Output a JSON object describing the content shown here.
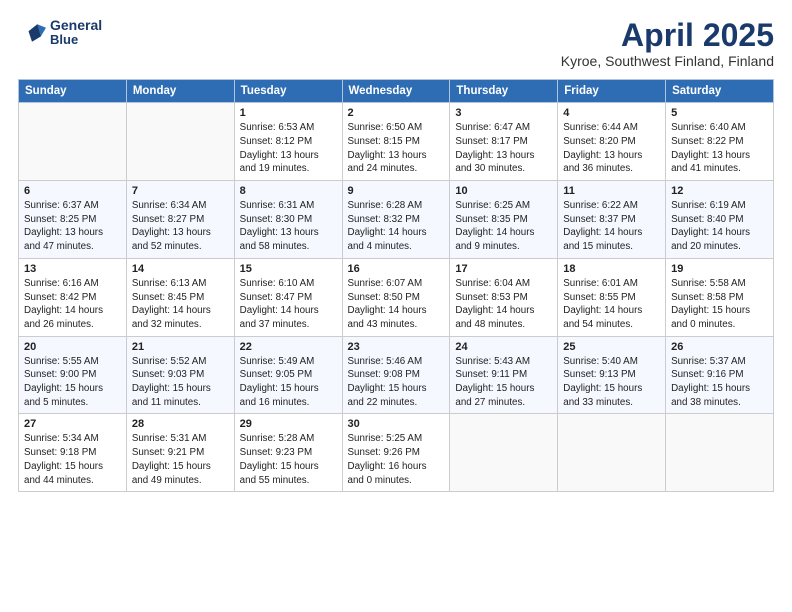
{
  "header": {
    "logo_line1": "General",
    "logo_line2": "Blue",
    "title": "April 2025",
    "subtitle": "Kyroe, Southwest Finland, Finland"
  },
  "weekdays": [
    "Sunday",
    "Monday",
    "Tuesday",
    "Wednesday",
    "Thursday",
    "Friday",
    "Saturday"
  ],
  "weeks": [
    [
      {
        "day": "",
        "detail": ""
      },
      {
        "day": "",
        "detail": ""
      },
      {
        "day": "1",
        "detail": "Sunrise: 6:53 AM\nSunset: 8:12 PM\nDaylight: 13 hours and 19 minutes."
      },
      {
        "day": "2",
        "detail": "Sunrise: 6:50 AM\nSunset: 8:15 PM\nDaylight: 13 hours and 24 minutes."
      },
      {
        "day": "3",
        "detail": "Sunrise: 6:47 AM\nSunset: 8:17 PM\nDaylight: 13 hours and 30 minutes."
      },
      {
        "day": "4",
        "detail": "Sunrise: 6:44 AM\nSunset: 8:20 PM\nDaylight: 13 hours and 36 minutes."
      },
      {
        "day": "5",
        "detail": "Sunrise: 6:40 AM\nSunset: 8:22 PM\nDaylight: 13 hours and 41 minutes."
      }
    ],
    [
      {
        "day": "6",
        "detail": "Sunrise: 6:37 AM\nSunset: 8:25 PM\nDaylight: 13 hours and 47 minutes."
      },
      {
        "day": "7",
        "detail": "Sunrise: 6:34 AM\nSunset: 8:27 PM\nDaylight: 13 hours and 52 minutes."
      },
      {
        "day": "8",
        "detail": "Sunrise: 6:31 AM\nSunset: 8:30 PM\nDaylight: 13 hours and 58 minutes."
      },
      {
        "day": "9",
        "detail": "Sunrise: 6:28 AM\nSunset: 8:32 PM\nDaylight: 14 hours and 4 minutes."
      },
      {
        "day": "10",
        "detail": "Sunrise: 6:25 AM\nSunset: 8:35 PM\nDaylight: 14 hours and 9 minutes."
      },
      {
        "day": "11",
        "detail": "Sunrise: 6:22 AM\nSunset: 8:37 PM\nDaylight: 14 hours and 15 minutes."
      },
      {
        "day": "12",
        "detail": "Sunrise: 6:19 AM\nSunset: 8:40 PM\nDaylight: 14 hours and 20 minutes."
      }
    ],
    [
      {
        "day": "13",
        "detail": "Sunrise: 6:16 AM\nSunset: 8:42 PM\nDaylight: 14 hours and 26 minutes."
      },
      {
        "day": "14",
        "detail": "Sunrise: 6:13 AM\nSunset: 8:45 PM\nDaylight: 14 hours and 32 minutes."
      },
      {
        "day": "15",
        "detail": "Sunrise: 6:10 AM\nSunset: 8:47 PM\nDaylight: 14 hours and 37 minutes."
      },
      {
        "day": "16",
        "detail": "Sunrise: 6:07 AM\nSunset: 8:50 PM\nDaylight: 14 hours and 43 minutes."
      },
      {
        "day": "17",
        "detail": "Sunrise: 6:04 AM\nSunset: 8:53 PM\nDaylight: 14 hours and 48 minutes."
      },
      {
        "day": "18",
        "detail": "Sunrise: 6:01 AM\nSunset: 8:55 PM\nDaylight: 14 hours and 54 minutes."
      },
      {
        "day": "19",
        "detail": "Sunrise: 5:58 AM\nSunset: 8:58 PM\nDaylight: 15 hours and 0 minutes."
      }
    ],
    [
      {
        "day": "20",
        "detail": "Sunrise: 5:55 AM\nSunset: 9:00 PM\nDaylight: 15 hours and 5 minutes."
      },
      {
        "day": "21",
        "detail": "Sunrise: 5:52 AM\nSunset: 9:03 PM\nDaylight: 15 hours and 11 minutes."
      },
      {
        "day": "22",
        "detail": "Sunrise: 5:49 AM\nSunset: 9:05 PM\nDaylight: 15 hours and 16 minutes."
      },
      {
        "day": "23",
        "detail": "Sunrise: 5:46 AM\nSunset: 9:08 PM\nDaylight: 15 hours and 22 minutes."
      },
      {
        "day": "24",
        "detail": "Sunrise: 5:43 AM\nSunset: 9:11 PM\nDaylight: 15 hours and 27 minutes."
      },
      {
        "day": "25",
        "detail": "Sunrise: 5:40 AM\nSunset: 9:13 PM\nDaylight: 15 hours and 33 minutes."
      },
      {
        "day": "26",
        "detail": "Sunrise: 5:37 AM\nSunset: 9:16 PM\nDaylight: 15 hours and 38 minutes."
      }
    ],
    [
      {
        "day": "27",
        "detail": "Sunrise: 5:34 AM\nSunset: 9:18 PM\nDaylight: 15 hours and 44 minutes."
      },
      {
        "day": "28",
        "detail": "Sunrise: 5:31 AM\nSunset: 9:21 PM\nDaylight: 15 hours and 49 minutes."
      },
      {
        "day": "29",
        "detail": "Sunrise: 5:28 AM\nSunset: 9:23 PM\nDaylight: 15 hours and 55 minutes."
      },
      {
        "day": "30",
        "detail": "Sunrise: 5:25 AM\nSunset: 9:26 PM\nDaylight: 16 hours and 0 minutes."
      },
      {
        "day": "",
        "detail": ""
      },
      {
        "day": "",
        "detail": ""
      },
      {
        "day": "",
        "detail": ""
      }
    ]
  ]
}
